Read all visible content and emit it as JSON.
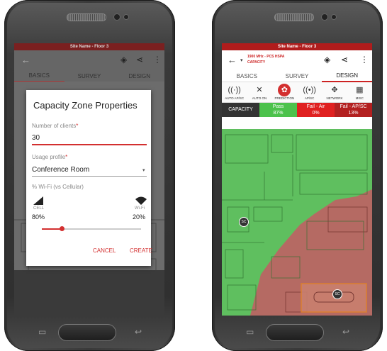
{
  "colors": {
    "accent": "#d32f2f",
    "green": "#5fbf5f",
    "red": "#d55"
  },
  "left": {
    "status_title": "Site Name - Floor 3",
    "dialog": {
      "title": "Capacity Zone Properties",
      "clients_label": "Number of clients",
      "clients_value": "30",
      "usage_label": "Usage profile",
      "usage_value": "Conference Room",
      "wifi_label": "% Wi-Fi (vs Cellular)",
      "cell_label": "CELL",
      "wifi_side_label": "Wi-Fi",
      "cell_value": "80%",
      "wifi_value": "20%",
      "slider_value": 0.2,
      "cancel": "CANCEL",
      "create": "CREATE",
      "required_mark": "*"
    },
    "tabs": [
      "BASICS",
      "SURVEY",
      "DESIGN"
    ]
  },
  "right": {
    "status_title": "Site Name - Floor 3",
    "title_line1": "1900 MHz - PCS HSPA",
    "title_line2": "CAPACITY",
    "tabs": [
      "BASICS",
      "SURVEY",
      "DESIGN"
    ],
    "tools": [
      "AUTO AP/SC",
      "AUTO ON",
      "PREDICTION",
      "AP/SC",
      "NETWORK",
      "MISC"
    ],
    "capacity_label": "CAPACITY",
    "pass_label": "Pass",
    "pass_value": "87%",
    "failair_label": "Fail - Air",
    "failair_value": "0%",
    "failap_label": "Fail - AP/SC",
    "failap_value": "13%",
    "marker": "SC"
  }
}
